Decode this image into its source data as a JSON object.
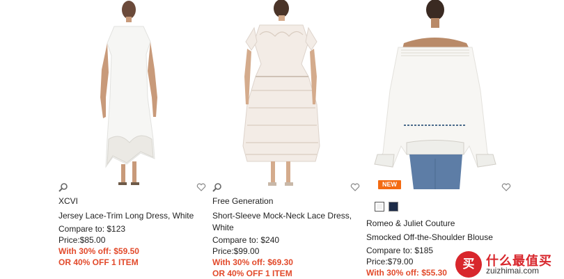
{
  "products": [
    {
      "brand": "XCVI",
      "name": "Jersey Lace-Trim Long Dress, White",
      "compare": "Compare to: $123",
      "price": "Price:$85.00",
      "sale": "With 30% off: $59.50",
      "offer": "OR 40% OFF 1 ITEM"
    },
    {
      "brand": "Free Generation",
      "name_line1": "Short-Sleeve Mock-Neck Lace Dress,",
      "name_line2": "White",
      "compare": "Compare to: $240",
      "price": "Price:$99.00",
      "sale": "With 30% off: $69.30",
      "offer": "OR 40% OFF 1 ITEM"
    },
    {
      "badge": "NEW",
      "brand": "Romeo & Juliet Couture",
      "name": "Smocked Off-the-Shoulder Blouse",
      "compare": "Compare to: $185",
      "price": "Price:$79.00",
      "sale": "With 30% off: $55.30",
      "swatch_colors": [
        "#ffffff",
        "#1c2b48"
      ]
    }
  ],
  "icons": {
    "zoom": "zoom-icon",
    "wishlist": "heart-icon"
  },
  "watermark": {
    "logo_char": "买",
    "cn": "什么最值买",
    "en": "zuizhimai.com"
  },
  "colors": {
    "sale": "#e24a2b",
    "badge": "#f36a12",
    "watermark": "#d8262c"
  }
}
